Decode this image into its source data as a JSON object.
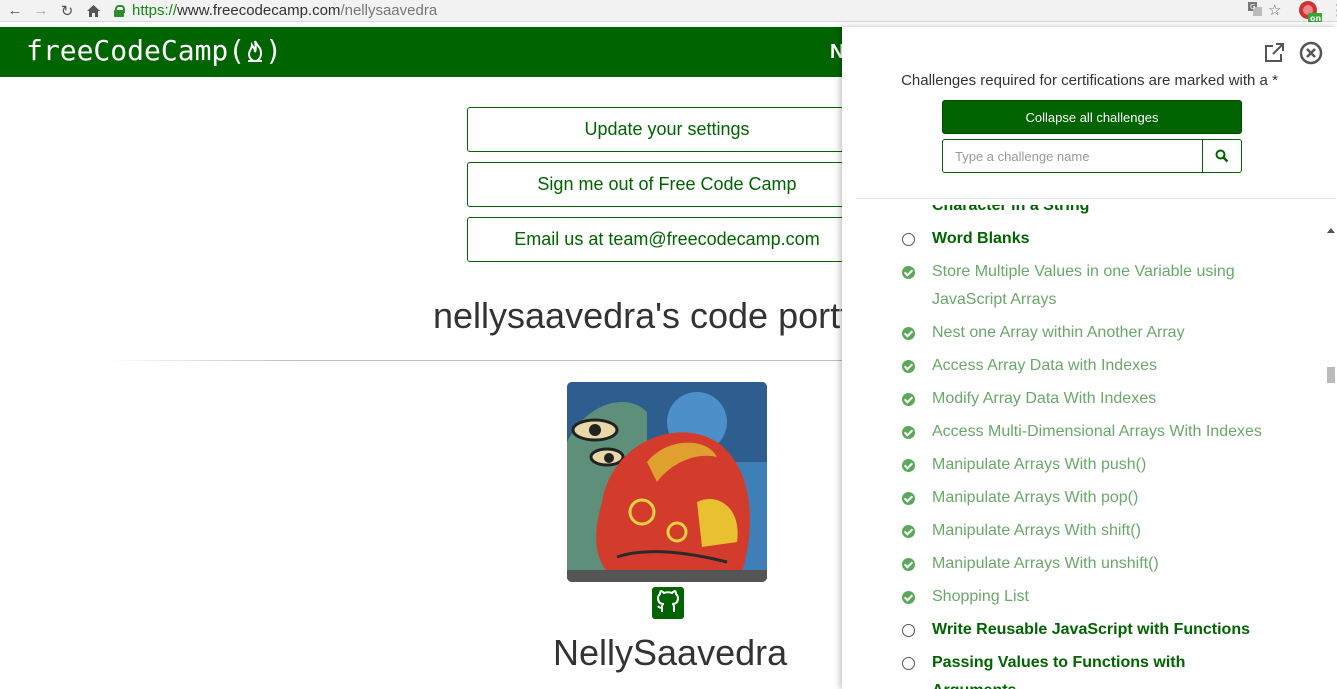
{
  "browser": {
    "url_scheme": "https://",
    "url_host": "www.freecodecamp.com",
    "url_path": "/nellysaavedra",
    "back_icon": "back-arrow-icon",
    "forward_icon": "forward-arrow-icon",
    "reload_icon": "reload-icon",
    "home_icon": "home-icon",
    "extension_badge": "on"
  },
  "navbar": {
    "brand": "freeCodeCamp(",
    "brand_end": ")",
    "nav_initial": "N"
  },
  "main": {
    "buttons": [
      {
        "label": "Update your settings"
      },
      {
        "label": "Sign me out of Free Code Camp"
      },
      {
        "label": "Email us at team@freecodecamp.com"
      }
    ],
    "portfolio_title": "nellysaavedra's code portf",
    "username": "NellySaavedra"
  },
  "panel": {
    "requirement_note": "Challenges required for certifications are marked with a *",
    "collapse_label": "Collapse all challenges",
    "search_placeholder": "Type a challenge name",
    "challenges": [
      {
        "title": "Character in a String",
        "status": "open"
      },
      {
        "title": "Word Blanks",
        "status": "open"
      },
      {
        "title": "Store Multiple Values in one Variable using",
        "title_line2": "JavaScript Arrays",
        "status": "done"
      },
      {
        "title": "Nest one Array within Another Array",
        "status": "done"
      },
      {
        "title": "Access Array Data with Indexes",
        "status": "done"
      },
      {
        "title": "Modify Array Data With Indexes",
        "status": "done"
      },
      {
        "title": "Access Multi-Dimensional Arrays With Indexes",
        "status": "done"
      },
      {
        "title": "Manipulate Arrays With push()",
        "status": "done"
      },
      {
        "title": "Manipulate Arrays With pop()",
        "status": "done"
      },
      {
        "title": "Manipulate Arrays With shift()",
        "status": "done"
      },
      {
        "title": "Manipulate Arrays With unshift()",
        "status": "done"
      },
      {
        "title": "Shopping List",
        "status": "done"
      },
      {
        "title": "Write Reusable JavaScript with Functions",
        "status": "open"
      },
      {
        "title": "Passing Values to Functions with Arguments",
        "status": "open"
      }
    ]
  },
  "colors": {
    "brand_green": "#006400",
    "done_green": "#6aa86a"
  }
}
